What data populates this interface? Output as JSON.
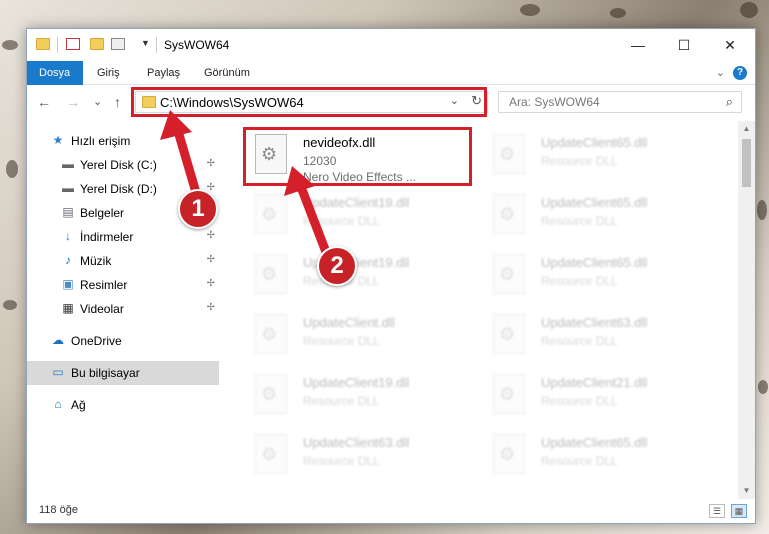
{
  "window": {
    "title": "SysWOW64",
    "controls": {
      "minimize": "—",
      "maximize": "☐",
      "close": "✕"
    }
  },
  "ribbon": {
    "tabs": [
      "Dosya",
      "Giriş",
      "Paylaş",
      "Görünüm"
    ],
    "active_tab": "Dosya",
    "expand_glyph": "⌄",
    "help_glyph": "?"
  },
  "nav": {
    "back_glyph": "←",
    "forward_glyph": "→",
    "recent_glyph": "⌄",
    "up_glyph": "↑",
    "address": "C:\\Windows\\SysWOW64",
    "address_dropdown_glyph": "⌄",
    "refresh_glyph": "↻",
    "search_placeholder": "Ara: SysWOW64",
    "search_glyph": "⌕"
  },
  "sidebar": {
    "items": [
      {
        "label": "Hızlı erişim",
        "icon": "star-icon",
        "glyph": "★",
        "pinned": false
      },
      {
        "label": "Yerel Disk (C:)",
        "icon": "drive-icon",
        "glyph": "▬",
        "pinned": true
      },
      {
        "label": "Yerel Disk (D:)",
        "icon": "drive-icon",
        "glyph": "▬",
        "pinned": true
      },
      {
        "label": "Belgeler",
        "icon": "documents-icon",
        "glyph": "▤",
        "pinned": true
      },
      {
        "label": "İndirmeler",
        "icon": "downloads-icon",
        "glyph": "↓",
        "pinned": true
      },
      {
        "label": "Müzik",
        "icon": "music-icon",
        "glyph": "♪",
        "pinned": true
      },
      {
        "label": "Resimler",
        "icon": "pictures-icon",
        "glyph": "▣",
        "pinned": true
      },
      {
        "label": "Videolar",
        "icon": "videos-icon",
        "glyph": "▦",
        "pinned": true
      },
      {
        "label": "OneDrive",
        "icon": "cloud-icon",
        "glyph": "☁",
        "pinned": false
      },
      {
        "label": "Bu bilgisayar",
        "icon": "computer-icon",
        "glyph": "▭",
        "pinned": false
      },
      {
        "label": "Ağ",
        "icon": "network-icon",
        "glyph": "⌂",
        "pinned": false
      }
    ],
    "selected": "Bu bilgisayar",
    "pin_glyph": "✢"
  },
  "files": {
    "highlighted": {
      "name": "nevideofx.dll",
      "meta": "12030",
      "desc": "Nero Video Effects ..."
    },
    "column_left": [
      {
        "name": "UpdateClient19.dll",
        "type": "Resource DLL"
      },
      {
        "name": "UpdateClient19.dll",
        "type": "Resource DLL"
      },
      {
        "name": "UpdateClient.dll",
        "type": "Resource DLL"
      },
      {
        "name": "UpdateClient19.dll",
        "type": "Resource DLL"
      },
      {
        "name": "UpdateClient63.dll",
        "type": "Resource DLL"
      }
    ],
    "column_right": [
      {
        "name": "UpdateClient65.dll",
        "type": "Resource DLL"
      },
      {
        "name": "UpdateClient65.dll",
        "type": "Resource DLL"
      },
      {
        "name": "UpdateClient65.dll",
        "type": "Resource DLL"
      },
      {
        "name": "UpdateClient63.dll",
        "type": "Resource DLL"
      },
      {
        "name": "UpdateClient21.dll",
        "type": "Resource DLL"
      },
      {
        "name": "UpdateClient65.dll",
        "type": "Resource DLL"
      }
    ],
    "gear_glyph": "⚙"
  },
  "status": {
    "item_count": "118 öğe",
    "details_view_glyph": "☰",
    "tiles_view_glyph": "▦"
  },
  "annotations": {
    "marker_1": "1",
    "marker_2": "2",
    "color": "#d5202b"
  },
  "scrollbar": {
    "up_glyph": "▲",
    "down_glyph": "▼"
  }
}
